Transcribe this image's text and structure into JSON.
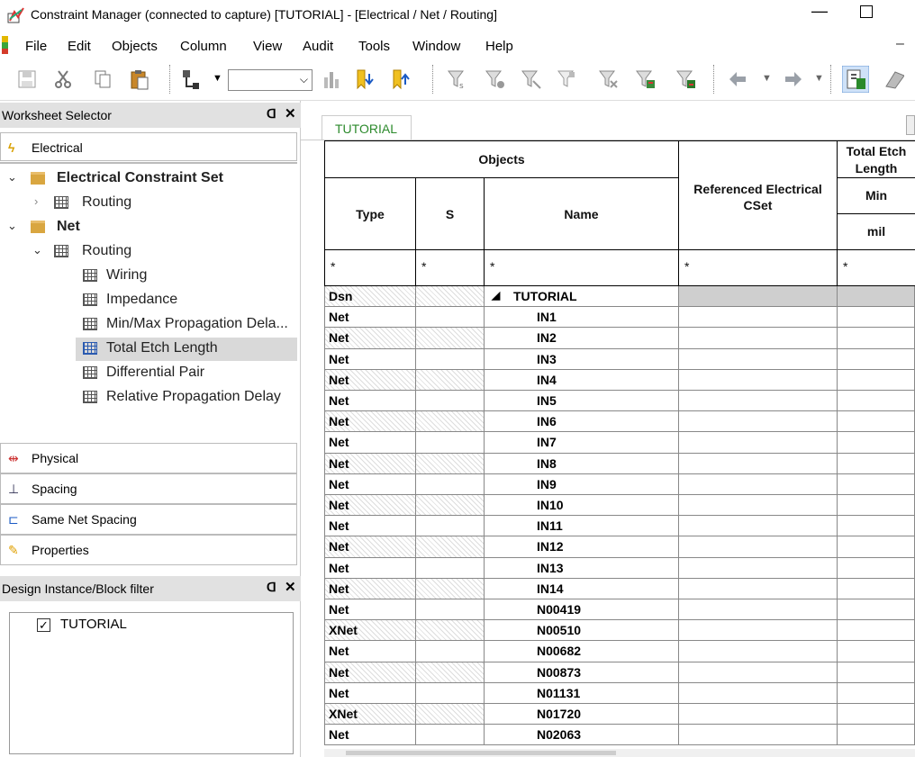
{
  "window": {
    "title": "Constraint Manager (connected to capture) [TUTORIAL] - [Electrical / Net / Routing]",
    "minimize_glyph": "—"
  },
  "menu": [
    "File",
    "Edit",
    "Objects",
    "Column",
    "View",
    "Audit",
    "Tools",
    "Window",
    "Help"
  ],
  "toolbar": {
    "combo_value": "",
    "icons": [
      "save-icon",
      "cut-icon",
      "copy-icon",
      "paste-icon",
      "probe-icon",
      "chart-icon",
      "bookmark-down-icon",
      "bookmark-up-icon",
      "filter-icon",
      "filter-clear-icon",
      "filter-a-icon",
      "filter-b-icon",
      "filter-c-icon",
      "filter-d-icon",
      "filter-e-icon",
      "back-arrow-icon",
      "forward-arrow-icon",
      "worksheet-icon",
      "next-icon"
    ]
  },
  "worksheet_selector": {
    "title": "Worksheet Selector",
    "electrical_label": "Electrical",
    "tree": {
      "ecs_label": "Electrical Constraint Set",
      "ecs_routing": "Routing",
      "net_label": "Net",
      "net_routing": "Routing",
      "worksheets": [
        "Wiring",
        "Impedance",
        "Min/Max Propagation Dela...",
        "Total Etch Length",
        "Differential Pair",
        "Relative Propagation Delay"
      ],
      "selected_index": 3
    },
    "categories": [
      "Physical",
      "Spacing",
      "Same Net Spacing",
      "Properties"
    ]
  },
  "instance_filter": {
    "title": "Design Instance/Block filter",
    "item_label": "TUTORIAL",
    "item_checked": "✓"
  },
  "tab": {
    "label": "TUTORIAL"
  },
  "grid": {
    "objects_header": "Objects",
    "type_header": "Type",
    "s_header": "S",
    "name_header": "Name",
    "ref_cset_header": "Referenced Electrical CSet",
    "total_etch_header": "Total Etch Length",
    "min_header": "Min",
    "unit_header": "mil",
    "filter_value": "*",
    "rows": [
      {
        "type": "Dsn",
        "name": "TUTORIAL",
        "is_design": true,
        "expander": "◢"
      },
      {
        "type": "Net",
        "name": "IN1"
      },
      {
        "type": "Net",
        "name": "IN2"
      },
      {
        "type": "Net",
        "name": "IN3"
      },
      {
        "type": "Net",
        "name": "IN4"
      },
      {
        "type": "Net",
        "name": "IN5"
      },
      {
        "type": "Net",
        "name": "IN6"
      },
      {
        "type": "Net",
        "name": "IN7"
      },
      {
        "type": "Net",
        "name": "IN8"
      },
      {
        "type": "Net",
        "name": "IN9"
      },
      {
        "type": "Net",
        "name": "IN10"
      },
      {
        "type": "Net",
        "name": "IN11"
      },
      {
        "type": "Net",
        "name": "IN12"
      },
      {
        "type": "Net",
        "name": "IN13"
      },
      {
        "type": "Net",
        "name": "IN14"
      },
      {
        "type": "Net",
        "name": "N00419"
      },
      {
        "type": "XNet",
        "name": "N00510"
      },
      {
        "type": "Net",
        "name": "N00682"
      },
      {
        "type": "Net",
        "name": "N00873"
      },
      {
        "type": "Net",
        "name": "N01131"
      },
      {
        "type": "XNet",
        "name": "N01720"
      },
      {
        "type": "Net",
        "name": "N02063"
      }
    ]
  }
}
